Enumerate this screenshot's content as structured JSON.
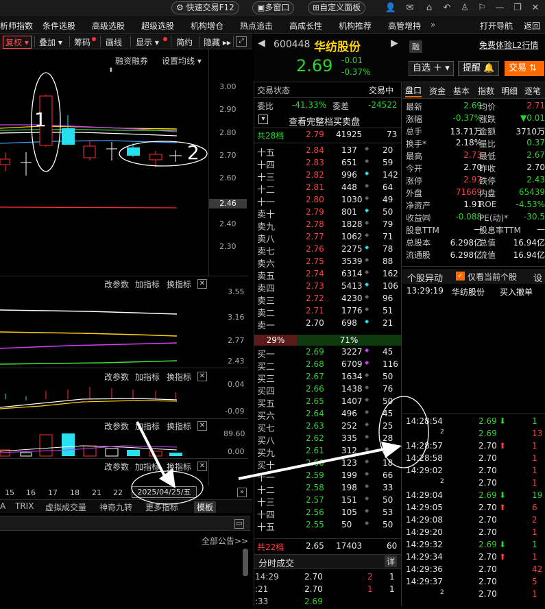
{
  "topbar": {
    "quick_trade": "快速交易F12",
    "multi_window": "多窗口",
    "custom_panel": "自定义面板"
  },
  "menu": [
    "析师指数",
    "条件选股",
    "高级选股",
    "超级选股",
    "机构增仓",
    "热点追击",
    "高成长性",
    "机构推荐",
    "高管增持",
    "打开导航",
    "返回"
  ],
  "menu_more": "»",
  "ktoolbar": {
    "fuquan": "复权",
    "diejia": "叠加",
    "chouma": "筹码",
    "huaxian": "画线",
    "xianshi": "显示",
    "jianyue": "简约",
    "yincang": "隐藏"
  },
  "chart_top": {
    "rzrq": "融资融券",
    "set_ma": "设置均线"
  },
  "price_axis": [
    "3.00",
    "2.90",
    "2.80",
    "2.70",
    "2.60",
    "2.50",
    "2.40",
    "2.30"
  ],
  "current_price_tag": "2.46",
  "annotations": {
    "n1": "1",
    "n2": "2",
    "date_tag": "2025/04/25/五"
  },
  "ind1": {
    "params": "改参数",
    "add": "加指标",
    "switch": "换指标",
    "axis": [
      "3.55",
      "3.16",
      "2.77",
      "2.43"
    ]
  },
  "ind2": {
    "params": "改参数",
    "add": "加指标",
    "switch": "换指标",
    "axis": [
      "0.04",
      "-0.09"
    ]
  },
  "ind3": {
    "params": "改参数",
    "add": "加指标",
    "switch": "换指标",
    "axis": [
      "89.60",
      "0.00"
    ]
  },
  "ind4": {
    "params": "改参数",
    "add": "加指标",
    "switch": "换指标"
  },
  "x_dates": [
    "15",
    "16",
    "17",
    "18",
    "21",
    "22"
  ],
  "ind_tabs": [
    "A",
    "TRIX",
    "虚拟成交量",
    "神奇九转",
    "更多指标",
    "模板"
  ],
  "notice_all": "全部公告>>",
  "stock": {
    "code": "600448",
    "name": "华纺股份",
    "price": "2.69",
    "change": "-0.01",
    "pct": "-0.37%",
    "rong": "融",
    "l2": "免费体验L2行情",
    "zixuan": "自选",
    "tixing": "提醒",
    "jiaoyi": "交易"
  },
  "mid": {
    "status_label": "交易状态",
    "status_val": "交易中",
    "weibi_label": "委比",
    "weibi": "-41.33%",
    "weicha_label": "委差",
    "weicha": "-24522",
    "full_order": "查看完整档买卖盘",
    "sell_total_label": "共28档",
    "sell_total_price": "2.79",
    "sell_total_vol": "41925",
    "sell_total_n": "73",
    "ratio_left": "29%",
    "ratio_right": "71%",
    "buy_total_label": "共22档",
    "buy_total_price": "2.65",
    "buy_total_vol": "17403",
    "buy_total_n": "60",
    "ticks_title": "分时成交",
    "ticks_btn": "详"
  },
  "asks": [
    {
      "l": "十五",
      "p": "2.84",
      "v": "137",
      "m": "◆",
      "n": "20"
    },
    {
      "l": "十四",
      "p": "2.83",
      "v": "651",
      "m": "◆",
      "n": "59"
    },
    {
      "l": "十三",
      "p": "2.82",
      "v": "996",
      "m": "◆",
      "n": "142"
    },
    {
      "l": "十二",
      "p": "2.81",
      "v": "448",
      "m": "◆",
      "n": "64"
    },
    {
      "l": "十一",
      "p": "2.80",
      "v": "1030",
      "m": "◆",
      "n": "49"
    },
    {
      "l": "卖十",
      "p": "2.79",
      "v": "801",
      "m": "◆",
      "n": "50"
    },
    {
      "l": "卖九",
      "p": "2.78",
      "v": "1828",
      "m": "◆",
      "n": "79"
    },
    {
      "l": "卖八",
      "p": "2.77",
      "v": "1062",
      "m": "◆",
      "n": "71"
    },
    {
      "l": "卖七",
      "p": "2.76",
      "v": "2275",
      "m": "◆",
      "n": "78"
    },
    {
      "l": "卖六",
      "p": "2.75",
      "v": "3539",
      "m": "◆",
      "n": "88"
    },
    {
      "l": "卖五",
      "p": "2.74",
      "v": "6314",
      "m": "◆",
      "n": "162"
    },
    {
      "l": "卖四",
      "p": "2.73",
      "v": "5413",
      "m": "◆",
      "n": "106"
    },
    {
      "l": "卖三",
      "p": "2.72",
      "v": "4230",
      "m": "◆",
      "n": "96"
    },
    {
      "l": "卖二",
      "p": "2.71",
      "v": "1776",
      "m": "◆",
      "n": "51"
    },
    {
      "l": "卖一",
      "p": "2.70",
      "v": "698",
      "m": "◆",
      "n": "21"
    }
  ],
  "bids": [
    {
      "l": "买一",
      "p": "2.69",
      "v": "3227",
      "m": "◆",
      "n": "45"
    },
    {
      "l": "买二",
      "p": "2.68",
      "v": "6709",
      "m": "◆",
      "n": "116"
    },
    {
      "l": "买三",
      "p": "2.67",
      "v": "1634",
      "m": "◆",
      "n": "50"
    },
    {
      "l": "买四",
      "p": "2.66",
      "v": "1438",
      "m": "◆",
      "n": "76"
    },
    {
      "l": "买五",
      "p": "2.65",
      "v": "1407",
      "m": "◆",
      "n": "50"
    },
    {
      "l": "买六",
      "p": "2.64",
      "v": "496",
      "m": "◆",
      "n": "45"
    },
    {
      "l": "买七",
      "p": "2.63",
      "v": "252",
      "m": "◆",
      "n": "25"
    },
    {
      "l": "买八",
      "p": "2.62",
      "v": "335",
      "m": "◆",
      "n": "28"
    },
    {
      "l": "买九",
      "p": "2.61",
      "v": "312",
      "m": "◆",
      "n": "22"
    },
    {
      "l": "买十",
      "p": "2.60",
      "v": "123",
      "m": "◆",
      "n": "18"
    },
    {
      "l": "十一",
      "p": "2.59",
      "v": "199",
      "m": "◆",
      "n": "66"
    },
    {
      "l": "十二",
      "p": "2.58",
      "v": "198",
      "m": "◆",
      "n": "33"
    },
    {
      "l": "十三",
      "p": "2.57",
      "v": "151",
      "m": "◆",
      "n": "50"
    },
    {
      "l": "十四",
      "p": "2.56",
      "v": "105",
      "m": "◆",
      "n": "53"
    },
    {
      "l": "十五",
      "p": "2.55",
      "v": "50",
      "m": "◆",
      "n": "50"
    }
  ],
  "ticks": [
    {
      "t": "14:29",
      "p": "2.70",
      "v": "2",
      "n": "1"
    },
    {
      "t": ":21",
      "p": "2.70",
      "v": "1",
      "n": "1"
    },
    {
      "t": ":33",
      "p": "2.69",
      "v": "",
      "n": ""
    }
  ],
  "rtabs": [
    "盘口",
    "资金",
    "基本",
    "指数",
    "明细",
    "逐笔"
  ],
  "quote": [
    [
      "最新",
      "2.69",
      "均价",
      "2.71"
    ],
    [
      "涨幅",
      "-0.37%",
      "涨跌",
      "▼0.01"
    ],
    [
      "总手",
      "13.71万",
      "金额",
      "3710万"
    ],
    [
      "换手*",
      "2.18%",
      "量比",
      "0.37"
    ],
    [
      "最高",
      "2.73",
      "最低",
      "2.67"
    ],
    [
      "今开",
      "2.70",
      "昨收",
      "2.70"
    ],
    [
      "涨停",
      "2.97",
      "跌停",
      "2.43"
    ],
    [
      "外盘",
      "71669",
      "内盘",
      "65439"
    ],
    [
      "净资产",
      "1.91",
      "ROE",
      "-4.53%"
    ],
    [
      "收益㈣",
      "-0.088",
      "PE(动)*",
      "-30.5"
    ],
    [
      "股息TTM",
      "—",
      "股息率TTM",
      "—"
    ],
    [
      "总股本",
      "6.298亿",
      "总值",
      "16.94亿"
    ],
    [
      "流通股",
      "6.298亿",
      "流值",
      "16.94亿"
    ]
  ],
  "yidong": {
    "title": "个股异动",
    "only_current": "仅看当前个股",
    "set": "设",
    "time": "13:29:19",
    "name": "华纺股份",
    "event": "买入撤单"
  },
  "trades": [
    {
      "t": "14:28:54",
      "p": "2.69",
      "d": "down",
      "v": "1"
    },
    {
      "t": "2",
      "p": "2.69",
      "d": "",
      "v": "13"
    },
    {
      "t": "14:28:57",
      "p": "2.70",
      "d": "up",
      "v": "1"
    },
    {
      "t": "14:28:58",
      "p": "2.70",
      "d": "",
      "v": "1"
    },
    {
      "t": "14:29:02",
      "p": "2.70",
      "d": "",
      "v": "1"
    },
    {
      "t": "2",
      "p": "2.70",
      "d": "",
      "v": "1"
    },
    {
      "t": "14:29:04",
      "p": "2.69",
      "d": "down",
      "v": "19"
    },
    {
      "t": "14:29:05",
      "p": "2.70",
      "d": "up",
      "v": "6"
    },
    {
      "t": "14:29:08",
      "p": "2.70",
      "d": "",
      "v": "2"
    },
    {
      "t": "14:29:20",
      "p": "2.70",
      "d": "",
      "v": "1"
    },
    {
      "t": "14:29:32",
      "p": "2.69",
      "d": "down",
      "v": "1"
    },
    {
      "t": "14:29:34",
      "p": "2.70",
      "d": "up",
      "v": "1"
    },
    {
      "t": "14:29:36",
      "p": "2.70",
      "d": "",
      "v": "42"
    },
    {
      "t": "14:29:37",
      "p": "2.70",
      "d": "",
      "v": "5"
    },
    {
      "t": "2",
      "p": "2.70",
      "d": "",
      "v": "1"
    }
  ],
  "colors": {
    "up": "#ff3d3d",
    "down": "#2bd62b",
    "accent": "#ff6a00",
    "cyan": "#26e0f0"
  }
}
